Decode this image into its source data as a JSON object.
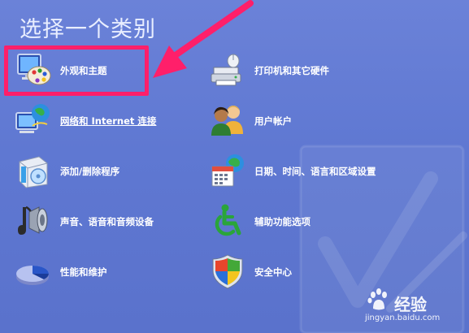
{
  "panel": {
    "title": "选择一个类别"
  },
  "categories": [
    {
      "label": "外观和主题",
      "icon": "appearance-palette-monitor-icon"
    },
    {
      "label": "打印机和其它硬件",
      "icon": "printer-mouse-icon"
    },
    {
      "label": "网络和 Internet 连接",
      "icon": "network-globe-icon"
    },
    {
      "label": "用户帐户",
      "icon": "user-accounts-icon"
    },
    {
      "label": "添加/删除程序",
      "icon": "add-remove-programs-icon"
    },
    {
      "label": "日期、时间、语言和区域设置",
      "icon": "date-time-globe-icon"
    },
    {
      "label": "声音、语音和音频设备",
      "icon": "speaker-audio-icon"
    },
    {
      "label": "辅助功能选项",
      "icon": "accessibility-wheelchair-icon"
    },
    {
      "label": "性能和维护",
      "icon": "performance-pie-icon"
    },
    {
      "label": "安全中心",
      "icon": "security-shield-icon"
    }
  ],
  "colors": {
    "background": "#6079d2",
    "highlight": "#ff1f6a",
    "label": "#ffffff"
  },
  "watermark": {
    "brand": "经验",
    "url": "jingyan.baidu.com"
  }
}
